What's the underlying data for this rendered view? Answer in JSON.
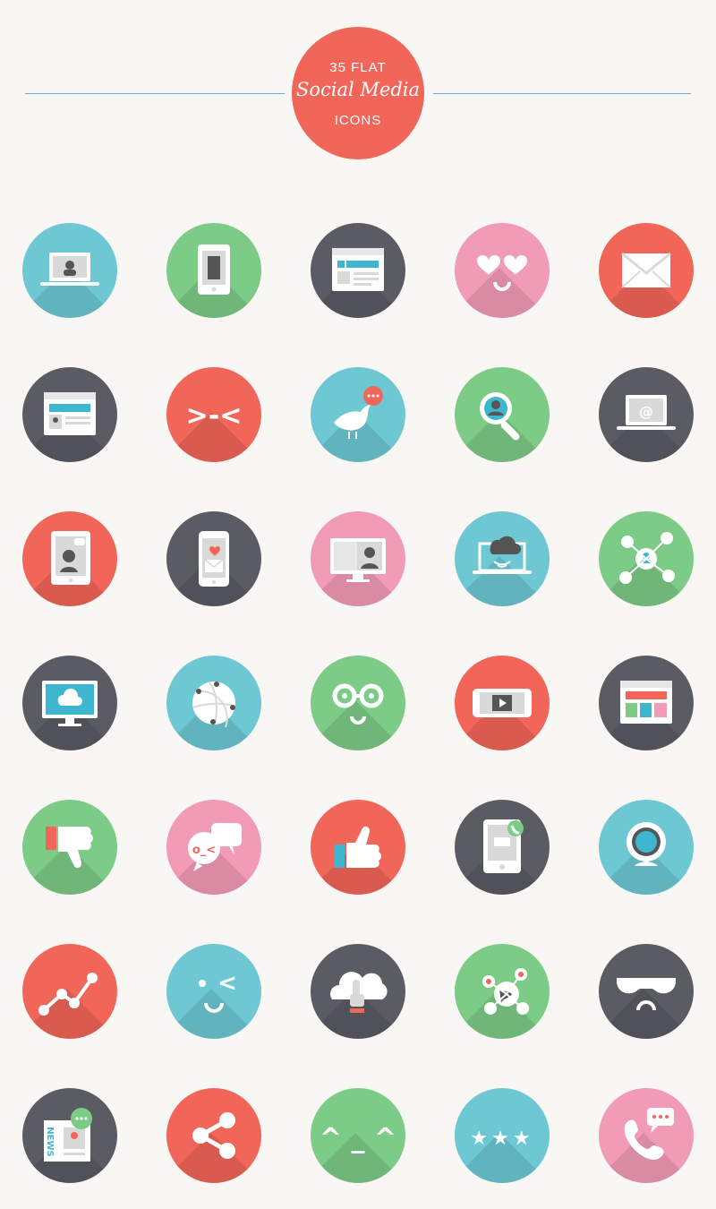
{
  "header": {
    "line1": "35 FLAT",
    "line2": "Social Media",
    "line3": "ICONS"
  },
  "colors": {
    "blue": "#6dc8d4",
    "green": "#7ccb86",
    "dark": "#5b5b64",
    "pink": "#f29bb6",
    "red": "#f2665a",
    "background": "#f9f7f3"
  },
  "icons": [
    {
      "name": "laptop-profile-icon",
      "color": "blue"
    },
    {
      "name": "tablet-ebook-icon",
      "color": "green"
    },
    {
      "name": "facebook-browser-icon",
      "color": "dark"
    },
    {
      "name": "heart-eyes-face-icon",
      "color": "pink"
    },
    {
      "name": "envelope-icon",
      "color": "red"
    },
    {
      "name": "twitter-browser-icon",
      "color": "dark"
    },
    {
      "name": "squint-face-icon",
      "color": "red"
    },
    {
      "name": "bird-chat-icon",
      "color": "blue"
    },
    {
      "name": "search-user-icon",
      "color": "green"
    },
    {
      "name": "laptop-email-icon",
      "color": "dark"
    },
    {
      "name": "tablet-chat-icon",
      "color": "red"
    },
    {
      "name": "phone-love-mail-icon",
      "color": "dark"
    },
    {
      "name": "video-call-monitor-icon",
      "color": "pink"
    },
    {
      "name": "laptop-cloud-icon",
      "color": "blue"
    },
    {
      "name": "user-network-icon",
      "color": "green"
    },
    {
      "name": "monitor-cloud-wifi-icon",
      "color": "dark"
    },
    {
      "name": "globe-network-icon",
      "color": "blue"
    },
    {
      "name": "glasses-face-icon",
      "color": "green"
    },
    {
      "name": "phone-video-icon",
      "color": "red"
    },
    {
      "name": "pinterest-browser-icon",
      "color": "dark"
    },
    {
      "name": "thumbs-down-icon",
      "color": "green"
    },
    {
      "name": "chat-bubbles-icon",
      "color": "pink"
    },
    {
      "name": "thumbs-up-icon",
      "color": "red"
    },
    {
      "name": "tablet-call-icon",
      "color": "dark"
    },
    {
      "name": "webcam-icon",
      "color": "blue"
    },
    {
      "name": "analytics-graph-icon",
      "color": "red"
    },
    {
      "name": "wink-face-icon",
      "color": "blue"
    },
    {
      "name": "cloud-touch-icon",
      "color": "dark"
    },
    {
      "name": "global-users-icon",
      "color": "green"
    },
    {
      "name": "sunglasses-face-icon",
      "color": "dark"
    },
    {
      "name": "news-chat-icon",
      "color": "dark"
    },
    {
      "name": "share-icon",
      "color": "red"
    },
    {
      "name": "caret-face-icon",
      "color": "green"
    },
    {
      "name": "star-rating-icon",
      "color": "blue"
    },
    {
      "name": "phone-call-chat-icon",
      "color": "pink"
    }
  ],
  "glyph_text": {
    "squint_face": ">-<",
    "laptop_email": "@",
    "news_label": "NEWS",
    "wink_mark": "<",
    "chat_face": "o_<",
    "stars": "★★★",
    "caret_face": "^ _ ^"
  }
}
